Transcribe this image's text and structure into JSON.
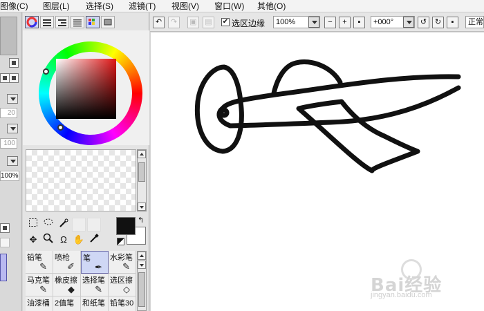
{
  "menu": [
    "图像(C)",
    "图层(L)",
    "选择(S)",
    "滤镜(T)",
    "视图(V)",
    "窗口(W)",
    "其他(O)"
  ],
  "left_panel": {
    "field_20": "20",
    "field_100": "100",
    "zoom": "100%"
  },
  "color": {
    "foreground": "#111111",
    "background": "#ffffff",
    "hue_marker": "red"
  },
  "brushes": [
    {
      "label": "铅笔",
      "icon": "pencil-icon"
    },
    {
      "label": "喷枪",
      "icon": "airbrush-icon"
    },
    {
      "label": "笔",
      "icon": "pen-icon",
      "selected": true
    },
    {
      "label": "水彩笔",
      "icon": "watercolor-icon"
    },
    {
      "label": "马克笔",
      "icon": "marker-icon"
    },
    {
      "label": "橡皮擦",
      "icon": "eraser-icon"
    },
    {
      "label": "选择笔",
      "icon": "select-pen-icon"
    },
    {
      "label": "选区擦",
      "icon": "select-eraser-icon"
    },
    {
      "label": "油漆桶",
      "icon": "bucket-icon"
    },
    {
      "label": "2值笔",
      "icon": "binary-pen-icon"
    },
    {
      "label": "和纸笔",
      "icon": "paper-pen-icon"
    },
    {
      "label": "铅笔30",
      "icon": "pencil30-icon"
    }
  ],
  "toolbar": {
    "selection_edge_label": "选区边缘",
    "selection_edge_checked": true,
    "zoom_value": "100%",
    "rotation_value": "+000°",
    "blend_mode": "正常"
  },
  "watermark": {
    "brand": "Bai经验",
    "url": "jingyan.baidu.com"
  }
}
